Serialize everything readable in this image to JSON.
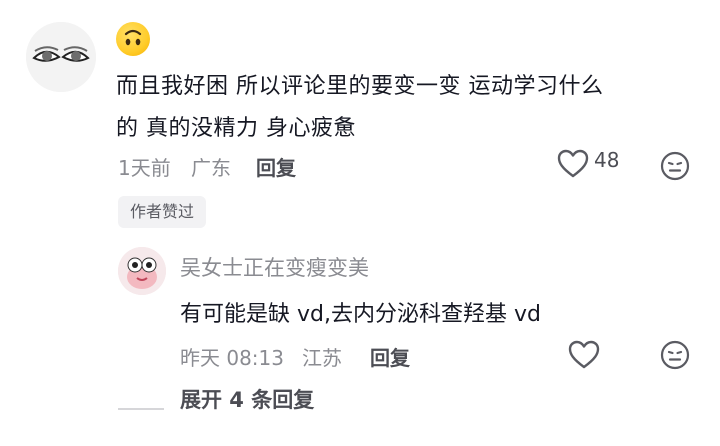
{
  "comment": {
    "emoji": "upside-down-face-emoji",
    "text_line1": "而且我好困 所以评论里的要变一变 运动学习什么",
    "text_line2": "的 真的没精力 身心疲惫",
    "time": "1天前",
    "location": "广东",
    "reply_label": "回复",
    "like_count": "48",
    "author_tag": "作者赞过"
  },
  "reply": {
    "username": "吴女士正在变瘦变美",
    "text": "有可能是缺 vd,去内分泌科查羟基 vd",
    "time": "昨天 08:13",
    "location": "江苏",
    "reply_label": "回复"
  },
  "expand_replies": "展开 4 条回复",
  "colors": {
    "text_primary": "#161823",
    "text_secondary": "#8a8b91",
    "tag_bg": "#f2f2f4"
  },
  "icons": {
    "like": "heart-outline-icon",
    "dislike": "frown-face-icon"
  }
}
